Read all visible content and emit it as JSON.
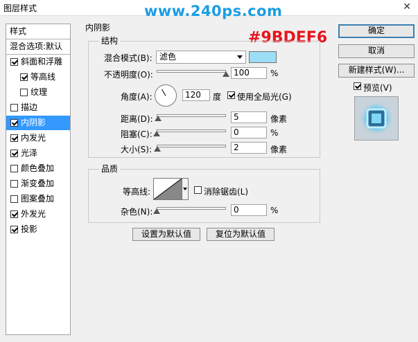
{
  "window": {
    "title": "图层样式",
    "close_glyph": "✕"
  },
  "watermark": "www.240ps.com",
  "annotation_hex": "#9BDEF6",
  "style_list": [
    {
      "label": "样式",
      "checkbox": false,
      "checked": false,
      "selected": false,
      "indent": 0
    },
    {
      "label": "混合选项:默认",
      "checkbox": false,
      "checked": false,
      "selected": false,
      "indent": 0
    },
    {
      "label": "斜面和浮雕",
      "checkbox": true,
      "checked": true,
      "selected": false,
      "indent": 0
    },
    {
      "label": "等高线",
      "checkbox": true,
      "checked": true,
      "selected": false,
      "indent": 1
    },
    {
      "label": "纹理",
      "checkbox": true,
      "checked": false,
      "selected": false,
      "indent": 1
    },
    {
      "label": "描边",
      "checkbox": true,
      "checked": false,
      "selected": false,
      "indent": 0
    },
    {
      "label": "内阴影",
      "checkbox": true,
      "checked": true,
      "selected": true,
      "indent": 0
    },
    {
      "label": "内发光",
      "checkbox": true,
      "checked": true,
      "selected": false,
      "indent": 0
    },
    {
      "label": "光泽",
      "checkbox": true,
      "checked": true,
      "selected": false,
      "indent": 0
    },
    {
      "label": "颜色叠加",
      "checkbox": true,
      "checked": false,
      "selected": false,
      "indent": 0
    },
    {
      "label": "渐变叠加",
      "checkbox": true,
      "checked": false,
      "selected": false,
      "indent": 0
    },
    {
      "label": "图案叠加",
      "checkbox": true,
      "checked": false,
      "selected": false,
      "indent": 0
    },
    {
      "label": "外发光",
      "checkbox": true,
      "checked": true,
      "selected": false,
      "indent": 0
    },
    {
      "label": "投影",
      "checkbox": true,
      "checked": true,
      "selected": false,
      "indent": 0
    }
  ],
  "panel": {
    "title": "内阴影",
    "structure": {
      "title": "结构",
      "blend_mode_label": "混合模式(B):",
      "blend_mode_value": "滤色",
      "color": "#9BDEF6",
      "opacity_label": "不透明度(O):",
      "opacity_value": "100",
      "opacity_unit": "%",
      "opacity_fraction": 1.0,
      "angle_label": "角度(A):",
      "angle_value": "120",
      "angle_unit": "度",
      "global_light_label": "使用全局光(G)",
      "global_light_checked": true,
      "distance_label": "距离(D):",
      "distance_value": "5",
      "distance_unit": "像素",
      "distance_fraction": 0.02,
      "choke_label": "阻塞(C):",
      "choke_value": "0",
      "choke_unit": "%",
      "choke_fraction": 0.0,
      "size_label": "大小(S):",
      "size_value": "2",
      "size_unit": "像素",
      "size_fraction": 0.01
    },
    "quality": {
      "title": "品质",
      "contour_label": "等高线:",
      "antialias_label": "消除锯齿(L)",
      "antialias_checked": false,
      "noise_label": "杂色(N):",
      "noise_value": "0",
      "noise_unit": "%",
      "noise_fraction": 0.0
    },
    "set_default_label": "设置为默认值",
    "reset_default_label": "复位为默认值"
  },
  "buttons": {
    "ok": "确定",
    "cancel": "取消",
    "new_style": "新建样式(W)...",
    "preview_label": "预览(V)",
    "preview_checked": true
  }
}
